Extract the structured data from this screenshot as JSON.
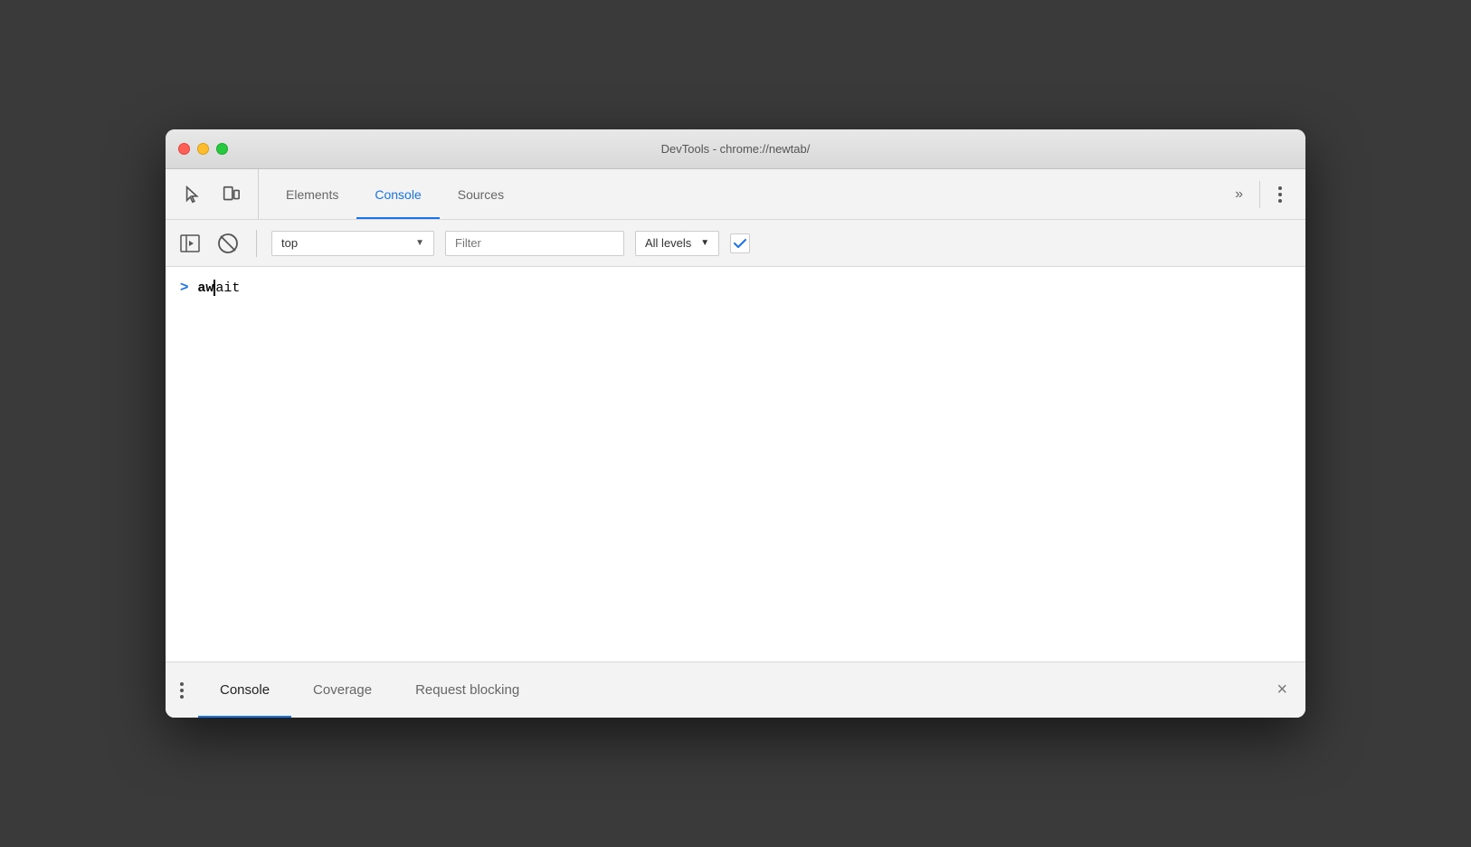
{
  "titleBar": {
    "title": "DevTools - chrome://newtab/"
  },
  "topToolbar": {
    "tabs": [
      {
        "id": "elements",
        "label": "Elements",
        "active": false
      },
      {
        "id": "console",
        "label": "Console",
        "active": true
      },
      {
        "id": "sources",
        "label": "Sources",
        "active": false
      }
    ],
    "moreTabsLabel": "»",
    "menuLabel": "⋮"
  },
  "consoleToolbar": {
    "contextValue": "top",
    "filterPlaceholder": "Filter",
    "allLevelsLabel": "All levels"
  },
  "consoleContent": {
    "promptSymbol": ">",
    "inputText": "await"
  },
  "bottomDrawer": {
    "tabs": [
      {
        "id": "console",
        "label": "Console",
        "active": true
      },
      {
        "id": "coverage",
        "label": "Coverage",
        "active": false
      },
      {
        "id": "request-blocking",
        "label": "Request blocking",
        "active": false
      }
    ],
    "closeLabel": "×"
  }
}
